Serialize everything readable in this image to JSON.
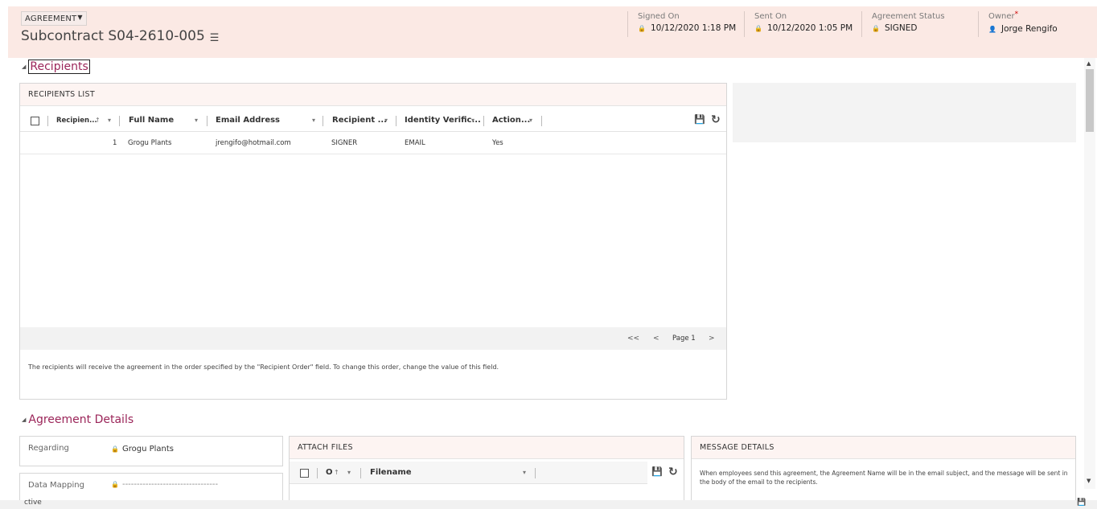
{
  "header": {
    "entity_label": "AGREEMENT",
    "record_title": "Subcontract S04-2610-005",
    "fields": [
      {
        "label": "Signed On",
        "value": "10/12/2020  1:18 PM"
      },
      {
        "label": "Sent On",
        "value": "10/12/2020  1:05 PM"
      },
      {
        "label": "Agreement Status",
        "value": "SIGNED"
      },
      {
        "label": "Owner",
        "value": "Jorge Rengifo"
      }
    ]
  },
  "recipients_section": {
    "heading": "Recipients",
    "list_title": "RECIPIENTS LIST",
    "columns": [
      "Recipien...",
      "Full Name",
      "Email Address",
      "Recipient ...",
      "Identity Verific...",
      "Action..."
    ],
    "rows": [
      {
        "order": "1",
        "full_name": "Grogu Plants",
        "email": "jrengifo@hotmail.com",
        "role": "SIGNER",
        "identity": "EMAIL",
        "action": "Yes"
      }
    ],
    "pager": {
      "first": "<<",
      "prev": "<",
      "page": "Page 1",
      "next": ">"
    },
    "note": "The recipients will receive the agreement in the order specified by the \"Recipient Order\" field. To change this order, change the value of this field."
  },
  "agreement_details": {
    "heading": "Agreement Details",
    "regarding_label": "Regarding",
    "regarding_value": "Grogu Plants",
    "data_mapping_label": "Data Mapping",
    "data_mapping_value": "---------------------------------",
    "attach_files": {
      "title": "ATTACH FILES",
      "columns": [
        "O",
        "Filename"
      ]
    },
    "message_details": {
      "title": "MESSAGE DETAILS",
      "text": "When employees send this agreement, the Agreement Name will be in the email subject, and the message will be sent in the body of the email to the recipients."
    }
  },
  "footer": {
    "text": "ctive"
  }
}
